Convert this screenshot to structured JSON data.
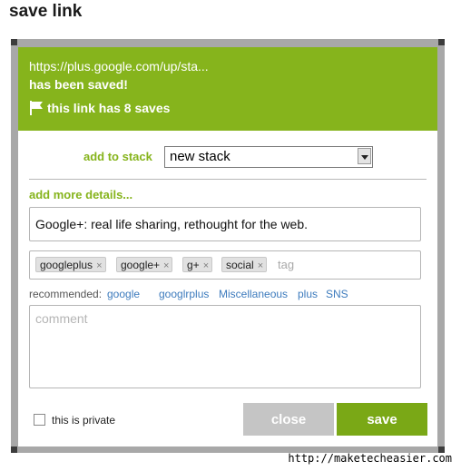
{
  "page": {
    "title": "save link"
  },
  "banner": {
    "url": "https://plus.google.com/up/sta...",
    "saved_text": "has been saved!",
    "saves_text": "this link has 8 saves",
    "icon": "flag-icon"
  },
  "stack": {
    "label": "add to stack",
    "selected": "new stack"
  },
  "details": {
    "link_label": "add more details...",
    "title_value": "Google+: real life sharing, rethought for the web."
  },
  "tags": {
    "items": [
      {
        "label": "googleplus"
      },
      {
        "label": "google+"
      },
      {
        "label": "g+"
      },
      {
        "label": "social"
      }
    ],
    "remove_glyph": "×",
    "placeholder": "tag"
  },
  "recommended": {
    "label": "recommended:",
    "items": [
      "google",
      "googlrplus",
      "Miscellaneous",
      "plus",
      "SNS"
    ]
  },
  "comment": {
    "placeholder": "comment"
  },
  "footer": {
    "private_label": "this is private",
    "private_checked": false,
    "close_label": "close",
    "save_label": "save"
  },
  "credit": "http://maketecheasier.com",
  "colors": {
    "accent": "#86b41c",
    "save_button": "#7aa816",
    "close_button": "#c5c5c5",
    "link": "#3d7bbd"
  }
}
